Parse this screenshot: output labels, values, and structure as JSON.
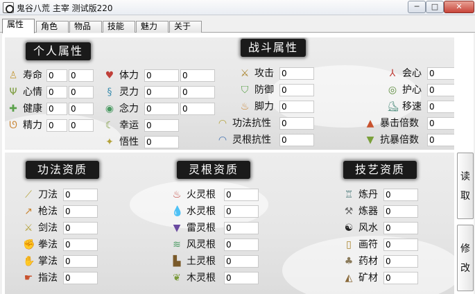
{
  "window": {
    "title": "鬼谷八荒 主宰 测试版220",
    "minimize": "─",
    "maximize": "□",
    "close": "✕"
  },
  "tabs": [
    "属性",
    "角色",
    "物品",
    "技能",
    "魅力",
    "关于"
  ],
  "sections": {
    "personal": "个人属性",
    "combat": "战斗属性",
    "gongfa": "功法资质",
    "linggen": "灵根资质",
    "skill": "技艺资质"
  },
  "personal": [
    {
      "label": "寿命",
      "icon": "person-icon",
      "v1": "0",
      "v2": "0"
    },
    {
      "label": "心情",
      "icon": "sprout-icon",
      "v1": "0",
      "v2": "0"
    },
    {
      "label": "健康",
      "icon": "cross-icon",
      "v1": "0",
      "v2": "0"
    },
    {
      "label": "精力",
      "icon": "arm-icon",
      "v1": "0",
      "v2": "0"
    },
    {
      "label": "体力",
      "icon": "heart-icon",
      "v1": "0",
      "v2": "0"
    },
    {
      "label": "灵力",
      "icon": "waves-icon",
      "v1": "0",
      "v2": "0"
    },
    {
      "label": "念力",
      "icon": "eye-icon",
      "v1": "0",
      "v2": "0"
    },
    {
      "label": "幸运",
      "icon": "moon-icon",
      "v1": "0"
    },
    {
      "label": "悟性",
      "icon": "star-icon",
      "v1": "0"
    }
  ],
  "combat": [
    {
      "label": "攻击",
      "icon": "swords-icon",
      "v": "0"
    },
    {
      "label": "防御",
      "icon": "shield-icon",
      "v": "0"
    },
    {
      "label": "脚力",
      "icon": "feet-icon",
      "v": "0"
    },
    {
      "label": "功法抗性",
      "icon": "dome-icon",
      "v": "0"
    },
    {
      "label": "灵根抗性",
      "icon": "dome-icon",
      "v": "0"
    },
    {
      "label": "会心",
      "icon": "trefoil-icon",
      "v": "0"
    },
    {
      "label": "护心",
      "icon": "ring-shield-icon",
      "v": "0"
    },
    {
      "label": "移速",
      "icon": "boot-icon",
      "v": "0"
    },
    {
      "label": "暴击倍数",
      "icon": "triple-triangle-icon",
      "v": "0"
    },
    {
      "label": "抗暴倍数",
      "icon": "triple-triangle-icon",
      "v": "0"
    }
  ],
  "gongfa": [
    {
      "label": "刀法",
      "icon": "blade-icon",
      "v": "0"
    },
    {
      "label": "枪法",
      "icon": "spear-icon",
      "v": "0"
    },
    {
      "label": "剑法",
      "icon": "sword-icon",
      "v": "0"
    },
    {
      "label": "拳法",
      "icon": "fist-icon",
      "v": "0"
    },
    {
      "label": "掌法",
      "icon": "palm-icon",
      "v": "0"
    },
    {
      "label": "指法",
      "icon": "finger-icon",
      "v": "0"
    }
  ],
  "linggen": [
    {
      "label": "火灵根",
      "icon": "fire-icon",
      "v": "0"
    },
    {
      "label": "水灵根",
      "icon": "drop-icon",
      "v": "0"
    },
    {
      "label": "雷灵根",
      "icon": "thunder-icon",
      "v": "0"
    },
    {
      "label": "风灵根",
      "icon": "wind-icon",
      "v": "0"
    },
    {
      "label": "土灵根",
      "icon": "earth-icon",
      "v": "0"
    },
    {
      "label": "木灵根",
      "icon": "leaf-icon",
      "v": "0"
    }
  ],
  "skill": [
    {
      "label": "炼丹",
      "icon": "cauldron-icon",
      "v": "0"
    },
    {
      "label": "炼器",
      "icon": "hammer-icon",
      "v": "0"
    },
    {
      "label": "风水",
      "icon": "yinyang-icon",
      "v": "0"
    },
    {
      "label": "画符",
      "icon": "scroll-icon",
      "v": "0"
    },
    {
      "label": "药材",
      "icon": "mushroom-icon",
      "v": "0"
    },
    {
      "label": "矿材",
      "icon": "ore-icon",
      "v": "0"
    }
  ],
  "side_buttons": {
    "read": [
      "读",
      "取"
    ],
    "modify": [
      "修",
      "改"
    ]
  }
}
